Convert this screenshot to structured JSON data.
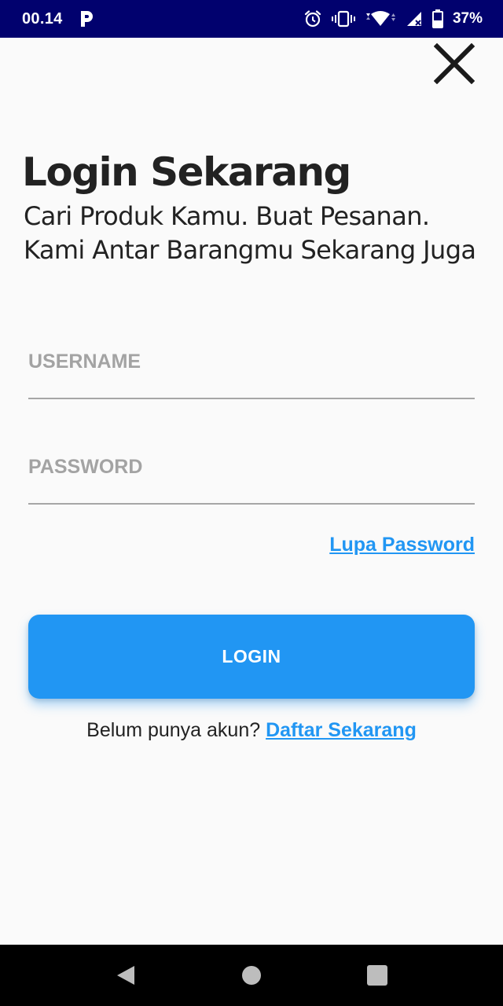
{
  "status_bar": {
    "time": "00.14",
    "battery_percent": "37%",
    "icons": [
      "parking-icon",
      "alarm-icon",
      "vibrate-icon",
      "wifi-icon",
      "signal-icon",
      "battery-icon"
    ],
    "background_color": "#01016e"
  },
  "header": {
    "close_icon": "close-icon"
  },
  "login": {
    "title": "Login Sekarang",
    "subtitle": "Cari Produk Kamu. Buat Pesanan. Kami Antar Barangmu Sekarang Juga",
    "username": {
      "placeholder": "USERNAME",
      "value": ""
    },
    "password": {
      "placeholder": "PASSWORD",
      "value": ""
    },
    "forgot_password_label": "Lupa Password",
    "login_button_label": "LOGIN",
    "register_prompt": "Belum punya akun?",
    "register_link_label": "Daftar Sekarang",
    "accent_color": "#2196f3"
  },
  "nav_bar": {
    "buttons": [
      "back-icon",
      "home-icon",
      "recents-icon"
    ]
  }
}
